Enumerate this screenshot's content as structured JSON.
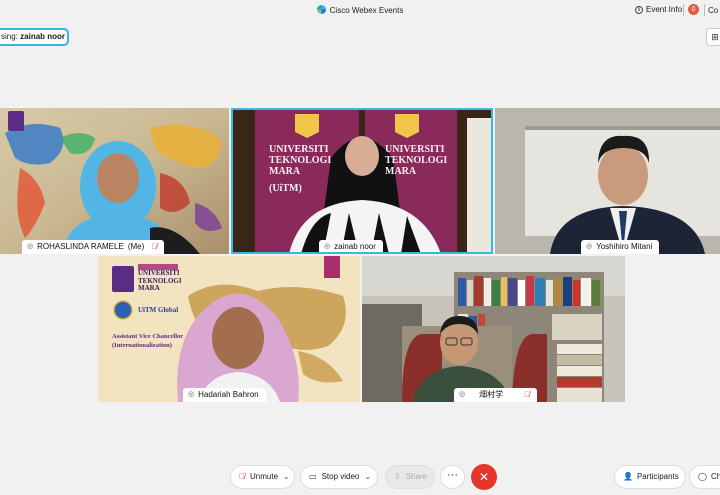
{
  "app": {
    "title": "Cisco Webex Events"
  },
  "topbar": {
    "event_info": "Event Info",
    "recording_count": "0",
    "chat_partial": "Co"
  },
  "speaking": {
    "prefix": "sing:",
    "name": "zainab noor"
  },
  "participants_grid": [
    {
      "name": "ROHASLINDA RAMELE",
      "suffix": "(Me)",
      "muted": true
    },
    {
      "name": "zainab noor",
      "muted": false,
      "active_speaker": true
    },
    {
      "name": "Yoshihiro Mitani",
      "muted": false
    },
    {
      "name": "Hadariah Bahron",
      "muted": false
    },
    {
      "name": "畑村学",
      "muted": true
    }
  ],
  "backgrounds": {
    "uitm_banner_line1": "UNIVERSITI",
    "uitm_banner_line2": "TEKNOLOGI",
    "uitm_banner_line3": "MARA",
    "uitm_banner_left1": "UNIVERSITI",
    "uitm_banner_left2": "TEKNOLOGI",
    "uitm_banner_left3": "MARA",
    "uitm_banner_left4": "(UiTM)",
    "hadariah_uni_line1": "UNIVERSITI",
    "hadariah_uni_line2": "TEKNOLOGI",
    "hadariah_uni_line3": "MARA",
    "hadariah_global": "UiTM Global",
    "hadariah_role1": "Assistant Vice Chancellor",
    "hadariah_role2": "(Internationalization)"
  },
  "controls": {
    "unmute": "Unmute",
    "stop_video": "Stop video",
    "share": "Share",
    "more": "···",
    "participants": "Participants",
    "chat_partial": "Ch"
  },
  "colors": {
    "accent": "#35b9e6",
    "end_call": "#e5362b",
    "muted": "#d24a3a"
  }
}
